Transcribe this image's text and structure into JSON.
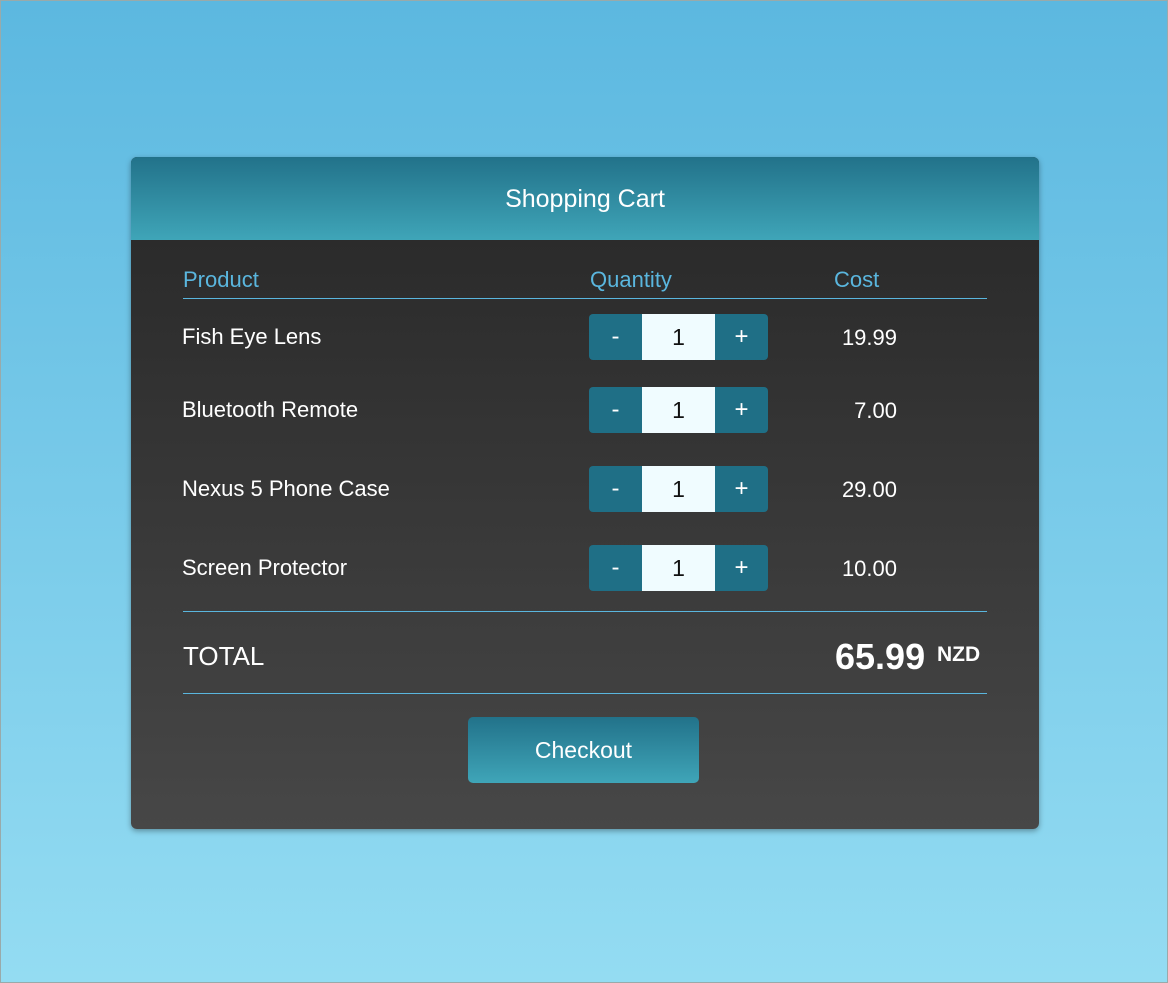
{
  "header": {
    "title": "Shopping Cart"
  },
  "columns": {
    "product": "Product",
    "quantity": "Quantity",
    "cost": "Cost"
  },
  "items": [
    {
      "name": "Fish Eye Lens",
      "quantity": "1",
      "cost": "19.99"
    },
    {
      "name": "Bluetooth Remote",
      "quantity": "1",
      "cost": "7.00"
    },
    {
      "name": "Nexus 5 Phone Case",
      "quantity": "1",
      "cost": "29.00"
    },
    {
      "name": "Screen Protector",
      "quantity": "1",
      "cost": "10.00"
    }
  ],
  "stepper": {
    "minus": "-",
    "plus": "+"
  },
  "total": {
    "label": "TOTAL",
    "value": "65.99",
    "currency": "NZD"
  },
  "checkout_label": "Checkout",
  "colors": {
    "accent": "#5ab6de",
    "header": "#2b8aa0",
    "stepper": "#1f6f86"
  }
}
